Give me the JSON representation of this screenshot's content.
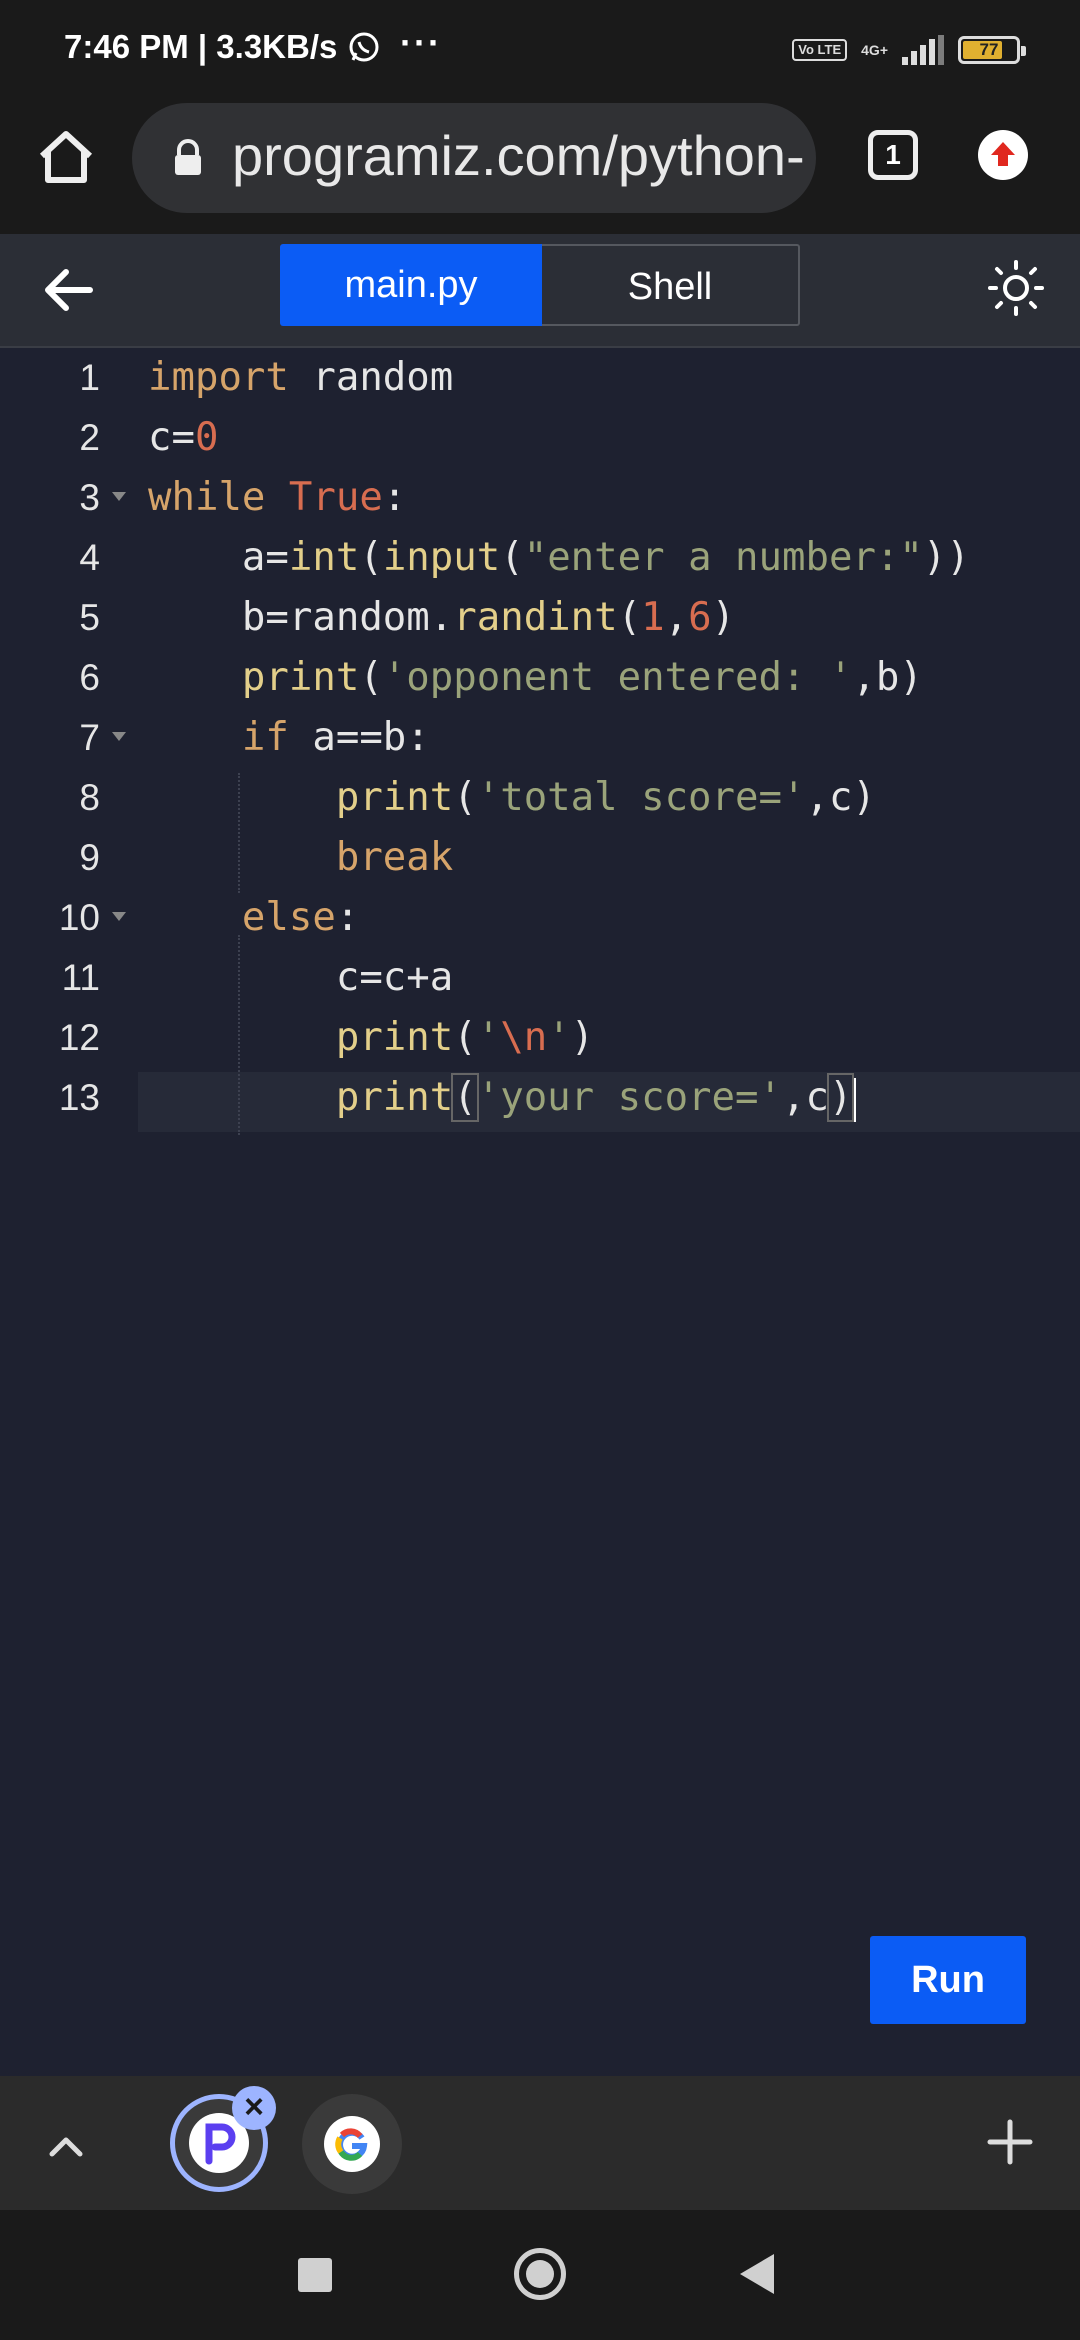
{
  "status_bar": {
    "time": "7:46 PM",
    "speed": "3.3KB/s",
    "overflow": "···",
    "volte": "Vo LTE",
    "network": "4G+",
    "battery": "77"
  },
  "browser": {
    "url": "programiz.com/python-",
    "tab_count": "1"
  },
  "editor": {
    "tabs": [
      {
        "label": "main.py",
        "active": true
      },
      {
        "label": "Shell",
        "active": false
      }
    ],
    "line_numbers": [
      "1",
      "2",
      "3",
      "4",
      "5",
      "6",
      "7",
      "8",
      "9",
      "10",
      "11",
      "12",
      "13"
    ],
    "code": [
      "import random",
      "c=0",
      "while True:",
      "    a=int(input(\"enter a number:\"))",
      "    b=random.randint(1,6)",
      "    print('opponent entered: ',b)",
      "    if a==b:",
      "        print('total score=',c)",
      "        break",
      "    else:",
      "        c=c+a",
      "        print('\\n')",
      "        print('your score=',c)"
    ],
    "run_label": "Run"
  },
  "colors": {
    "accent": "#0b5cf5",
    "editor_bg": "#1e2130",
    "keyword": "#d6a46a",
    "string": "#9aa37a",
    "number": "#d86d50"
  }
}
